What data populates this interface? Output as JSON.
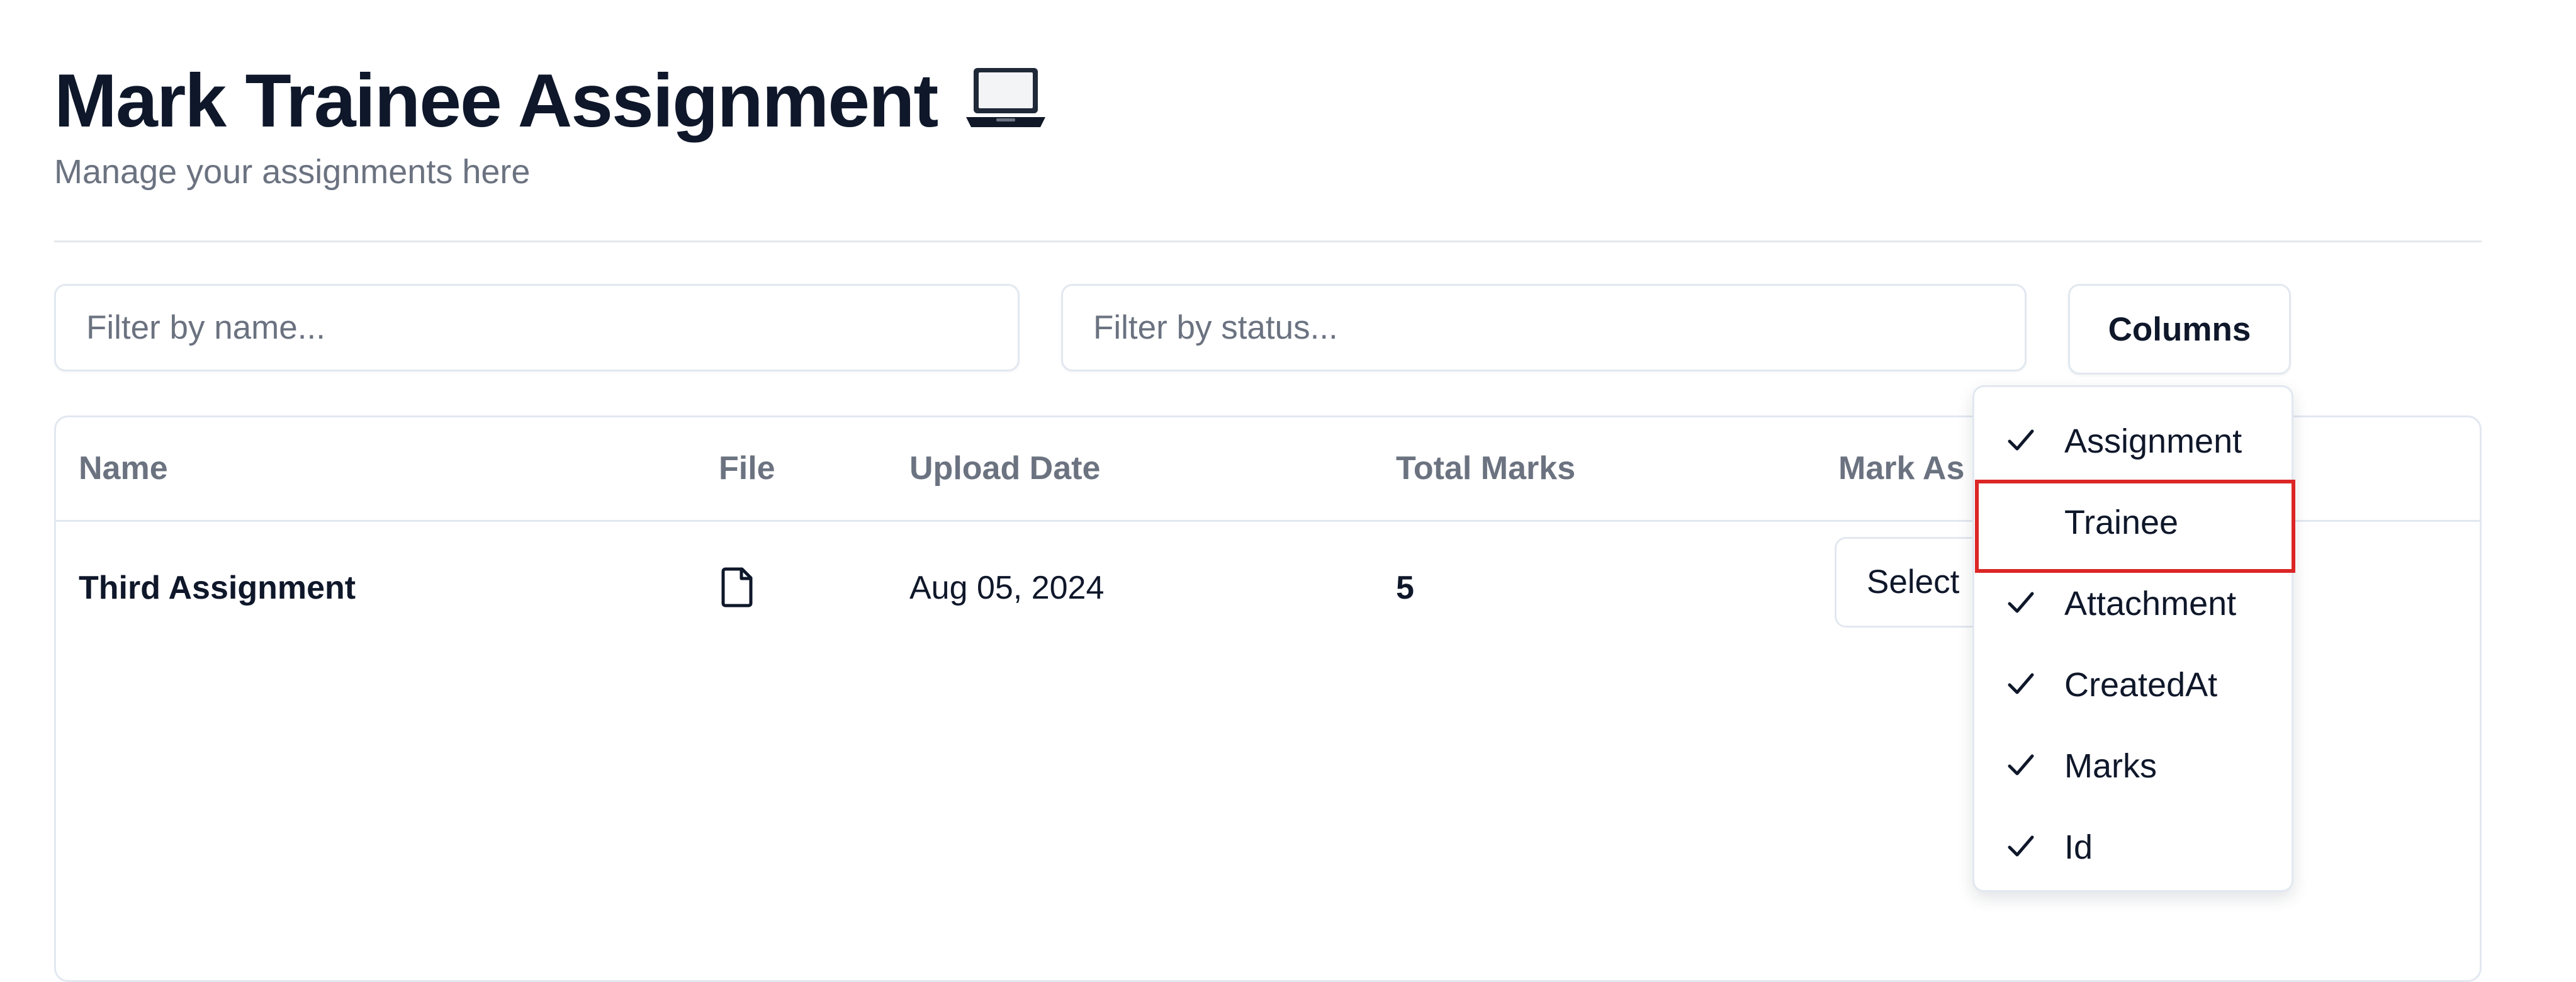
{
  "header": {
    "title": "Mark Trainee Assignment",
    "title_icon": "laptop-icon",
    "subtitle": "Manage your assignments here"
  },
  "filters": {
    "name_placeholder": "Filter by name...",
    "name_value": "",
    "status_placeholder": "Filter by status...",
    "status_value": ""
  },
  "toolbar": {
    "columns_label": "Columns"
  },
  "table": {
    "columns": [
      "Name",
      "File",
      "Upload Date",
      "Total Marks",
      "Mark As"
    ],
    "rows": [
      {
        "name": "Third Assignment",
        "file_icon": "file-icon",
        "upload_date": "Aug 05, 2024",
        "total_marks": "5",
        "mark_select": "Select"
      }
    ]
  },
  "columns_menu": {
    "items": [
      {
        "label": "Assignment",
        "checked": true
      },
      {
        "label": "Trainee",
        "checked": false,
        "highlighted": true
      },
      {
        "label": "Attachment",
        "checked": true
      },
      {
        "label": "CreatedAt",
        "checked": true
      },
      {
        "label": "Marks",
        "checked": true
      },
      {
        "label": "Id",
        "checked": true
      }
    ]
  },
  "colors": {
    "border": "#e2e8f0",
    "muted_text": "#6b7280",
    "text": "#0f172a",
    "highlight": "#dc2626"
  }
}
